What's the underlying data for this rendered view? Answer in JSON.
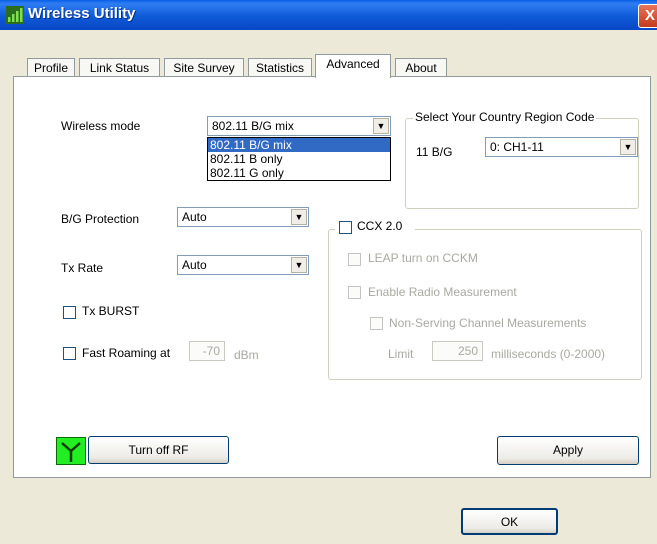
{
  "window": {
    "title": "Wireless Utility",
    "close_glyph": "X"
  },
  "tabs": [
    {
      "label": "Profile"
    },
    {
      "label": "Link Status"
    },
    {
      "label": "Site Survey"
    },
    {
      "label": "Statistics"
    },
    {
      "label": "Advanced"
    },
    {
      "label": "About"
    }
  ],
  "active_tab": "Advanced",
  "advanced": {
    "wireless_mode": {
      "label": "Wireless mode",
      "value": "802.11 B/G mix",
      "options": [
        "802.11 B/G mix",
        "802.11 B only",
        "802.11 G only"
      ]
    },
    "country": {
      "group_title": "Select Your Country Region Code",
      "band_label": "11 B/G",
      "value": "0: CH1-11"
    },
    "bg_protection": {
      "label": "B/G Protection",
      "value": "Auto"
    },
    "tx_rate": {
      "label": "Tx Rate",
      "value": "Auto"
    },
    "tx_burst": {
      "label": "Tx BURST",
      "checked": false
    },
    "fast_roaming": {
      "label": "Fast Roaming at",
      "value": "-70",
      "unit": "dBm",
      "checked": false
    },
    "ccx": {
      "label": "CCX 2.0",
      "checked": false,
      "leap_label": "LEAP turn on CCKM",
      "radio_label": "Enable Radio Measurement",
      "nonserving_label": "Non-Serving Channel Measurements",
      "limit_label": "Limit",
      "limit_value": "250",
      "limit_unit": "milliseconds (0-2000)"
    },
    "turn_off_rf_label": "Turn off RF",
    "apply_label": "Apply"
  },
  "ok_label": "OK",
  "icons": {
    "app": "signal-bars-icon",
    "rf": "antenna-icon"
  },
  "colors": {
    "title_bar": "#0a5fe6",
    "rf_led": "#22ee22",
    "selection": "#316ac5"
  }
}
